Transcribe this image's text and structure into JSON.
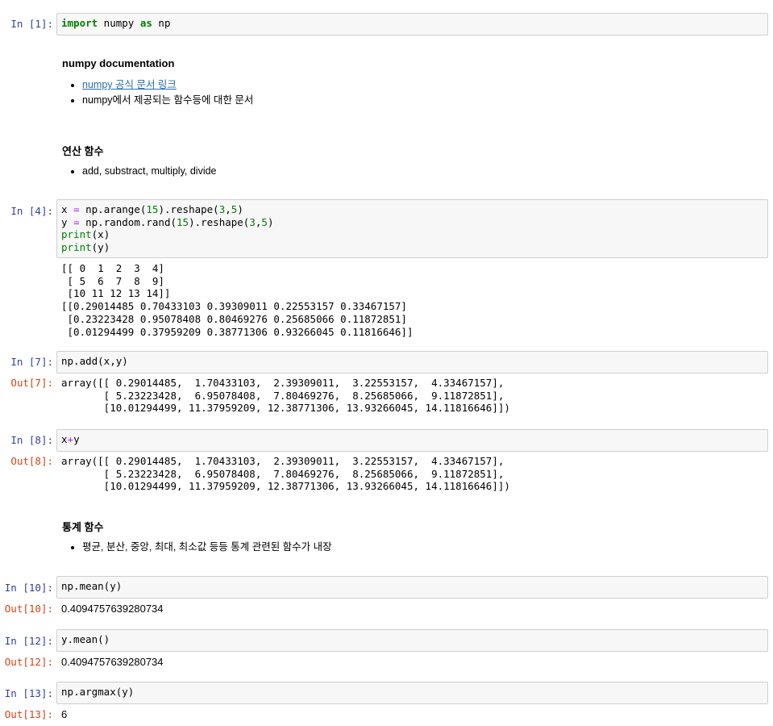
{
  "cells": {
    "c1": {
      "prompt": "In [1]:",
      "code_kw1": "import",
      "code_mid": " numpy ",
      "code_kw2": "as",
      "code_end": " np"
    },
    "md1": {
      "heading": "numpy documentation",
      "link_text": "numpy 공식 문서 링크",
      "bullet2": "numpy에서 제공되는 함수등에 대한 문서"
    },
    "md2": {
      "heading": "연산 함수",
      "bullet1": "add, substract, multiply, divide"
    },
    "c4": {
      "prompt": "In [4]:",
      "output": "[[ 0  1  2  3  4]\n [ 5  6  7  8  9]\n [10 11 12 13 14]]\n[[0.29014485 0.70433103 0.39309011 0.22553157 0.33467157]\n [0.23223428 0.95078408 0.80469276 0.25685066 0.11872851]\n [0.01294499 0.37959209 0.38771306 0.93266045 0.11816646]]"
    },
    "c7": {
      "prompt": "In [7]:",
      "code": "np.add(x,y)",
      "out_prompt": "Out[7]:",
      "output": "array([[ 0.29014485,  1.70433103,  2.39309011,  3.22553157,  4.33467157],\n       [ 5.23223428,  6.95078408,  7.80469276,  8.25685066,  9.11872851],\n       [10.01294499, 11.37959209, 12.38771306, 13.93266045, 14.11816646]])"
    },
    "c8": {
      "prompt": "In [8]:",
      "code_a": "x",
      "code_op": "+",
      "code_b": "y",
      "out_prompt": "Out[8]:",
      "output": "array([[ 0.29014485,  1.70433103,  2.39309011,  3.22553157,  4.33467157],\n       [ 5.23223428,  6.95078408,  7.80469276,  8.25685066,  9.11872851],\n       [10.01294499, 11.37959209, 12.38771306, 13.93266045, 14.11816646]])"
    },
    "md3": {
      "heading": "통계 함수",
      "bullet1": "평균, 분산, 중앙, 최대, 최소값 등등 통계 관련된 함수가 내장"
    },
    "c10": {
      "prompt": "In [10]:",
      "code": "np.mean(y)",
      "out_prompt": "Out[10]:",
      "output": "0.4094757639280734"
    },
    "c12": {
      "prompt": "In [12]:",
      "code": "y.mean()",
      "out_prompt": "Out[12]:",
      "output": "0.4094757639280734"
    },
    "c13": {
      "prompt": "In [13]:",
      "code": "np.argmax(y)",
      "out_prompt": "Out[13]:",
      "output": "6"
    }
  },
  "colors": {
    "in_prompt": "#303f9f",
    "out_prompt": "#d84315",
    "keyword": "#008000",
    "operator": "#aa22ff",
    "link": "#296eaa",
    "code_bg": "#f7f7f7",
    "code_border": "#cfcfcf"
  }
}
